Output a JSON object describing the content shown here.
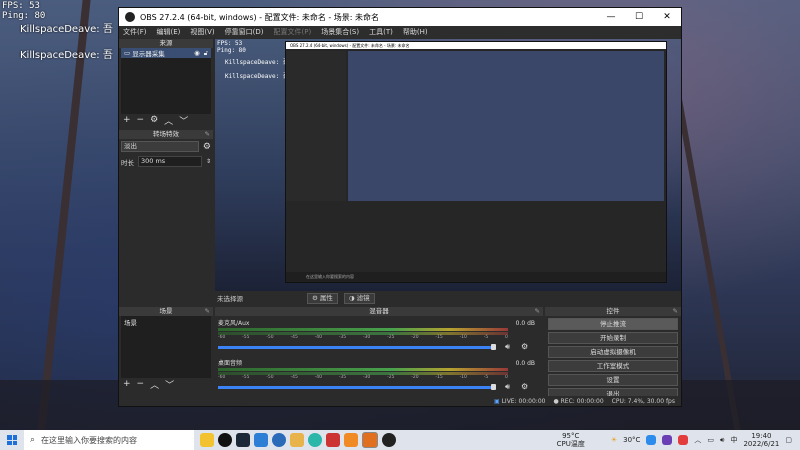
{
  "overlay": {
    "fps_label": "FPS:",
    "fps_value": "53",
    "ping_label": "Ping:",
    "ping_value": "80"
  },
  "chat": [
    {
      "text": "KillspaceDeave: 吾"
    },
    {
      "text": "KillspaceDeave: 吾"
    }
  ],
  "obs": {
    "title": "OBS 27.2.4 (64-bit, windows) - 配置文件: 未命名 - 场景: 未命名",
    "window_buttons": [
      "—",
      "☐",
      "✕"
    ],
    "menu": [
      "文件(F)",
      "编辑(E)",
      "视图(V)",
      "停靠窗口(D)",
      "配置文件(P)",
      "场景集合(S)",
      "工具(T)",
      "帮助(H)"
    ],
    "sources_title": "来源",
    "sources": [
      {
        "label": "显示器采集"
      }
    ],
    "filters_title": "转场特效",
    "filters_select": "淡出",
    "duration_label": "时长",
    "duration_value": "300 ms",
    "preview_overlay": {
      "fps": "FPS: 53",
      "ping": "Ping: 80",
      "chat1": "KillspaceDeave: 吾",
      "chat2": "KillspaceDeave: 吾"
    },
    "nested_title": "OBS 27.2.4 (64-bit, windows) - 配置文件: 未命名 - 场景: 未命名",
    "nested_search": "在这里输入你要搜索的内容",
    "studio_label": "未选择源",
    "props_button": "属性",
    "filter_button": "滤镜",
    "scenes_title": "场景",
    "scenes": [
      "场景"
    ],
    "mixer_title": "混音器",
    "mixer": [
      {
        "name": "麦克风/Aux",
        "db": "0.0 dB",
        "volume": 1.0
      },
      {
        "name": "桌面音频",
        "db": "0.0 dB",
        "volume": 1.0
      }
    ],
    "meter_ticks": [
      "-60",
      "-55",
      "-50",
      "-45",
      "-40",
      "-35",
      "-30",
      "-25",
      "-20",
      "-15",
      "-10",
      "-5",
      "0"
    ],
    "controls_title": "控件",
    "controls": [
      "停止推流",
      "开始录制",
      "启动虚拟摄像机",
      "工作室模式",
      "设置",
      "退出"
    ],
    "status": {
      "live": "LIVE: 00:00:00",
      "rec": "REC: 00:00:00",
      "cpu": "CPU: 7.4%, 30.00 fps"
    }
  },
  "taskbar": {
    "search_placeholder": "在这里输入你要搜索的内容",
    "weather_temp": "95°C",
    "weather_desc": "CPU温度",
    "temp": "30°C",
    "time": "19:40",
    "date": "2022/6/21"
  },
  "colors": {
    "obs_bg": "#2b2b2b",
    "accent": "#3b82f6",
    "taskbar": "#dfe4ec"
  }
}
